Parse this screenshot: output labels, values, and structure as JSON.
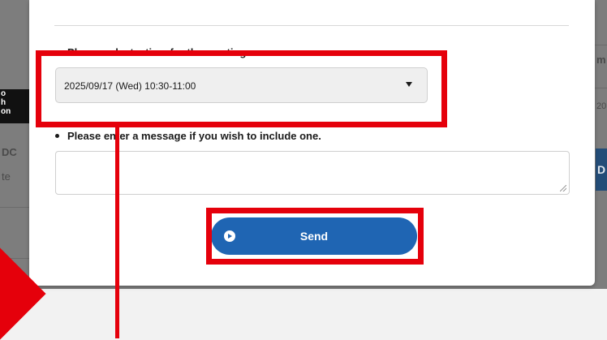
{
  "background_fragments": {
    "left_dark_tag": "o\nh\non",
    "left_text_1": "DC",
    "left_text_2": "te",
    "right_text_1": "m",
    "right_text_2": "20",
    "right_blue_tag": "D"
  },
  "modal": {
    "time_question": "Please select a time for the meeting.",
    "time_select": {
      "selected": "2025/09/17 (Wed)  10:30-11:00"
    },
    "message_question": "Please enter a message if you wish to include one.",
    "message_field": {
      "value": ""
    },
    "send_button": {
      "label": "Send",
      "icon": "arrow-circle-right-icon",
      "color": "#1f65b3"
    }
  },
  "annotation": {
    "highlight_color": "#e5000b"
  }
}
